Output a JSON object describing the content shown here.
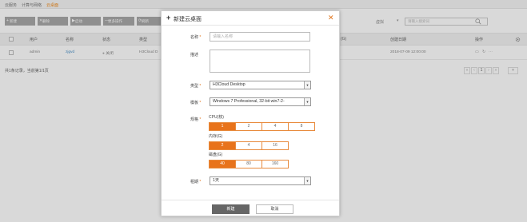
{
  "topnav": {
    "items": [
      "云服务",
      "计算与网络",
      "云桌面"
    ]
  },
  "toolbar": {
    "buttons": [
      {
        "icon": "+",
        "label": "新建"
      },
      {
        "icon": "✕",
        "label": "删除"
      },
      {
        "icon": "▶",
        "label": "启动"
      },
      {
        "icon": "—",
        "label": "更多操作"
      },
      {
        "icon": "⟳",
        "label": "刷新"
      }
    ]
  },
  "search": {
    "label": "虚拟",
    "placeholder": "请输入搜索词"
  },
  "table": {
    "columns": [
      "用户",
      "名称",
      "状态",
      "类型",
      "(G)",
      "创建日期",
      "操作"
    ],
    "rows": [
      {
        "user": "admin",
        "name": "zjgvd",
        "status": "关闭",
        "type": "H3Cloud D",
        "created": "2018-07-09 12:00:00"
      }
    ]
  },
  "footer": {
    "info": "共1条记录，当前第1/1页",
    "page": "1"
  },
  "dialog": {
    "title": "新建云桌面",
    "name_label": "名称",
    "name_placeholder": "请输入名称",
    "desc_label": "描述",
    "type_label": "类型",
    "type_value": "H3Cloud Desktop",
    "template_label": "模板",
    "template_value": "Windows 7 Professional, 32-bit win7-2-",
    "spec_label": "规格",
    "cpu_label": "CPU(核)",
    "cpu_options": [
      "1",
      "2",
      "4",
      "8"
    ],
    "cpu_selected": "1",
    "mem_label": "内存(G)",
    "mem_options": [
      "2",
      "4",
      "16"
    ],
    "mem_selected": "2",
    "disk_label": "磁盘(G)",
    "disk_options": [
      "40",
      "80",
      "160"
    ],
    "disk_selected": "40",
    "period_label": "租期",
    "period_value": "1天",
    "ok_label": "新建",
    "cancel_label": "取消"
  },
  "colors": {
    "accent": "#e8731b",
    "link": "#4a90c8",
    "button_gray": "#a9a9a9"
  }
}
